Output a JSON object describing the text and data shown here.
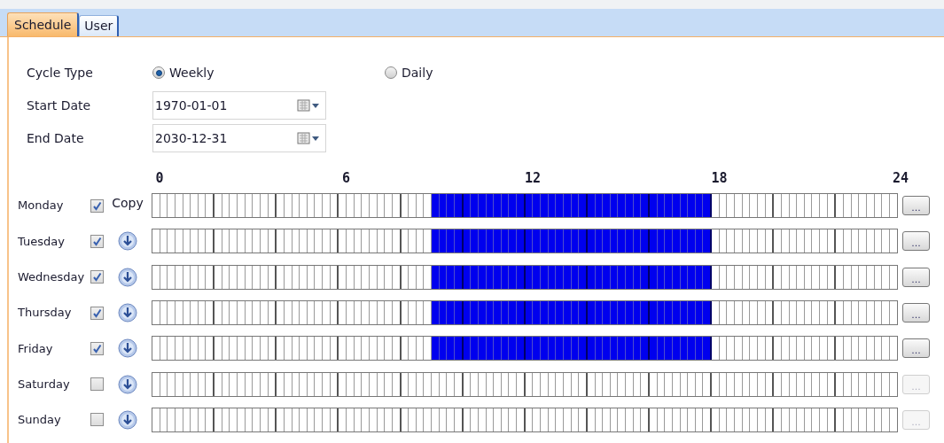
{
  "tabs": [
    {
      "label": "Schedule",
      "selected": true
    },
    {
      "label": "User",
      "selected": false
    }
  ],
  "cycle_type": {
    "label": "Cycle Type",
    "options": [
      {
        "label": "Weekly",
        "selected": true
      },
      {
        "label": "Daily",
        "selected": false
      }
    ]
  },
  "start_date": {
    "label": "Start Date",
    "value": "1970-01-01"
  },
  "end_date": {
    "label": "End Date",
    "value": "2030-12-31"
  },
  "timeline": {
    "ticks": [
      "0",
      "6",
      "12",
      "18",
      "24"
    ]
  },
  "days": [
    {
      "name": "Monday",
      "checked": true,
      "copy_label": "Copy",
      "hours": [
        false,
        false,
        false,
        false,
        false,
        false,
        false,
        false,
        false,
        true,
        true,
        true,
        true,
        true,
        true,
        true,
        true,
        true,
        false,
        false,
        false,
        false,
        false,
        false
      ],
      "button": "...",
      "disabled": false
    },
    {
      "name": "Tuesday",
      "checked": true,
      "hours": [
        false,
        false,
        false,
        false,
        false,
        false,
        false,
        false,
        false,
        true,
        true,
        true,
        true,
        true,
        true,
        true,
        true,
        true,
        false,
        false,
        false,
        false,
        false,
        false
      ],
      "button": "...",
      "disabled": false
    },
    {
      "name": "Wednesday",
      "checked": true,
      "hours": [
        false,
        false,
        false,
        false,
        false,
        false,
        false,
        false,
        false,
        true,
        true,
        true,
        true,
        true,
        true,
        true,
        true,
        true,
        false,
        false,
        false,
        false,
        false,
        false
      ],
      "button": "...",
      "disabled": false
    },
    {
      "name": "Thursday",
      "checked": true,
      "hours": [
        false,
        false,
        false,
        false,
        false,
        false,
        false,
        false,
        false,
        true,
        true,
        true,
        true,
        true,
        true,
        true,
        true,
        true,
        false,
        false,
        false,
        false,
        false,
        false
      ],
      "button": "...",
      "disabled": false
    },
    {
      "name": "Friday",
      "checked": true,
      "hours": [
        false,
        false,
        false,
        false,
        false,
        false,
        false,
        false,
        false,
        true,
        true,
        true,
        true,
        true,
        true,
        true,
        true,
        true,
        false,
        false,
        false,
        false,
        false,
        false
      ],
      "button": "...",
      "disabled": false
    },
    {
      "name": "Saturday",
      "checked": false,
      "hours": [
        false,
        false,
        false,
        false,
        false,
        false,
        false,
        false,
        false,
        false,
        false,
        false,
        false,
        false,
        false,
        false,
        false,
        false,
        false,
        false,
        false,
        false,
        false,
        false
      ],
      "button": "...",
      "disabled": true
    },
    {
      "name": "Sunday",
      "checked": false,
      "hours": [
        false,
        false,
        false,
        false,
        false,
        false,
        false,
        false,
        false,
        false,
        false,
        false,
        false,
        false,
        false,
        false,
        false,
        false,
        false,
        false,
        false,
        false,
        false,
        false
      ],
      "button": "...",
      "disabled": true
    }
  ]
}
